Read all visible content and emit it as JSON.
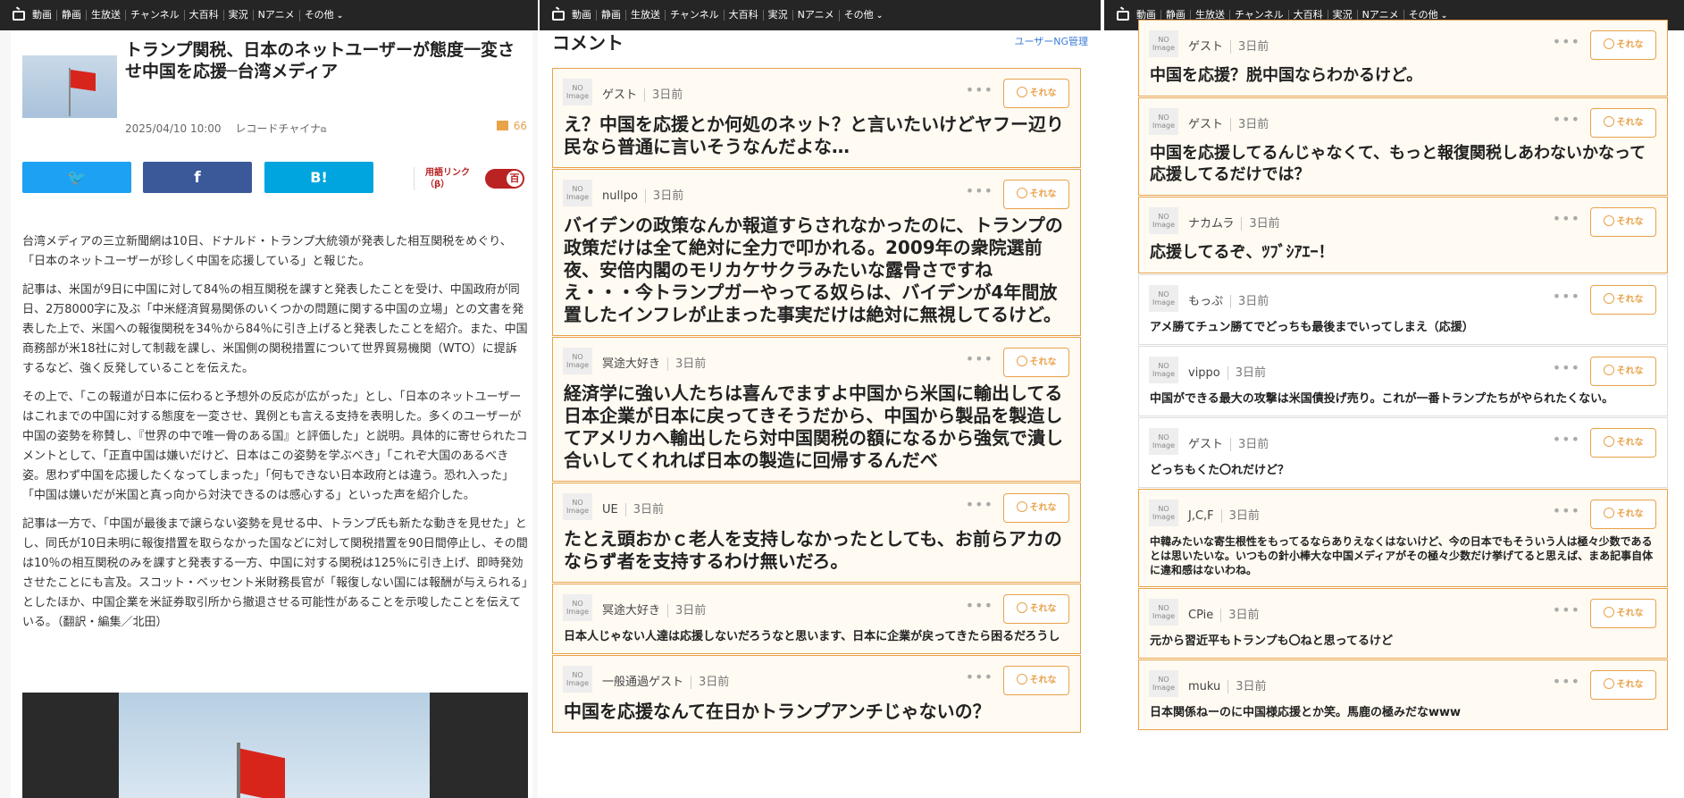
{
  "nav": {
    "items": [
      "動画",
      "静画",
      "生放送",
      "チャンネル",
      "大百科",
      "実況",
      "Nアニメ",
      "その他"
    ]
  },
  "article": {
    "title": "トランプ関税、日本のネットユーザーが態度一変させ中国を応援─台湾メディア",
    "date": "2025/04/10 10:00",
    "source": "レコードチャイナ",
    "comment_count": "66",
    "share": {
      "twitter": "twitter",
      "facebook": "f",
      "hatena": "B!"
    },
    "glossary_link": "用語リンク（β）",
    "toggle": "百",
    "paragraphs": [
      "台湾メディアの三立新聞網は10日、ドナルド・トランプ大統領が発表した相互関税をめぐり、「日本のネットユーザーが珍しく中国を応援している」と報じた。",
      "記事は、米国が9日に中国に対して84％の相互関税を課すと発表したことを受け、中国政府が同日、2万8000字に及ぶ「中米経済貿易関係のいくつかの問題に関する中国の立場」との文書を発表した上で、米国への報復関税を34％から84％に引き上げると発表したことを紹介。また、中国商務部が米18社に対して制裁を課し、米国側の関税措置について世界貿易機関（WTO）に提訴するなど、強く反発していることを伝えた。",
      "その上で、「この報道が日本に伝わると予想外の反応が広がった」とし、「日本のネットユーザーはこれまでの中国に対する態度を一変させ、異例とも言える支持を表明した。多くのユーザーが中国の姿勢を称賛し、『世界の中で唯一骨のある国』と評価した」と説明。具体的に寄せられたコメントとして、「正直中国は嫌いだけど、日本はこの姿勢を学ぶべき」「これぞ大国のあるべき姿。思わず中国を応援したくなってしまった」「何もできない日本政府とは違う。恐れ入った」「中国は嫌いだが米国と真っ向から対決できるのは感心する」といった声を紹介した。",
      "記事は一方で、「中国が最後まで譲らない姿勢を見せる中、トランプ氏も新たな動きを見せた」とし、同氏が10日未明に報復措置を取らなかった国などに対して関税措置を90日間停止し、その間は10％の相互関税のみを課すと発表する一方、中国に対する関税は125％に引き上げ、即時発効させたことにも言及。スコット・ベッセント米財務長官が「報復しない国には報酬が与えられる」としたほか、中国企業を米証券取引所から撤退させる可能性があることを示唆したことを伝えている。（翻訳・編集／北田）"
    ]
  },
  "comments_header": {
    "title": "コメント",
    "ng_manage": "ユーザーNG管理"
  },
  "common": {
    "no_image": "NO Image",
    "sorena": "それな",
    "dots": "•••"
  },
  "comments_mid": [
    {
      "user": "ゲスト",
      "time": "3日前",
      "text": "え？中国を応援とか何処のネット？と言いたいけどヤフー辺り民なら普通に言いそうなんだよな…"
    },
    {
      "user": "nullpo",
      "time": "3日前",
      "text": "バイデンの政策なんか報道すらされなかったのに、トランプの政策だけは全て絶対に全力で叩かれる。2009年の衆院選前夜、安倍内閣のモリカケサクラみたいな露骨さですね　え・・・今トランプガーやってる奴らは、バイデンが4年間放置したインフレが止まった事実だけは絶対に無視してるけど。"
    },
    {
      "user": "冥途大好き",
      "time": "3日前",
      "text": "経済学に強い人たちは喜んでますよ中国から米国に輸出してる日本企業が日本に戻ってきそうだから、中国から製品を製造してアメリカへ輸出したら対中国関税の額になるから強気で潰し合いしてくれれば日本の製造に回帰するんだべ"
    },
    {
      "user": "UE",
      "time": "3日前",
      "text": "たとえ頭おかｃ老人を支持しなかったとしても、お前らアカのならず者を支持するわけ無いだろ。"
    },
    {
      "user": "冥途大好き",
      "time": "3日前",
      "text": "日本人じゃない人達は応援しないだろうなと思います、日本に企業が戻ってきたら困るだろうし"
    },
    {
      "user": "一般通過ゲスト",
      "time": "3日前",
      "text": "中国を応援なんて在日かトランプアンチじゃないの？"
    }
  ],
  "comments_right": [
    {
      "user": "ゲスト",
      "time": "3日前",
      "text": "中国を応援？脱中国ならわかるけど。"
    },
    {
      "user": "ゲスト",
      "time": "3日前",
      "text": "中国を応援してるんじゃなくて、もっと報復関税しあわないかなって応援してるだけでは？"
    },
    {
      "user": "ナカムラ",
      "time": "3日前",
      "text": "応援してるぞ、ﾂﾌﾞｼｱｴｰ！"
    },
    {
      "user": "もっぷ",
      "time": "3日前",
      "text": "アメ勝てチュン勝てでどっちも最後までいってしまえ（応援）"
    },
    {
      "user": "vippo",
      "time": "3日前",
      "text": "中国ができる最大の攻撃は米国債投げ売り。これが一番トランプたちがやられたくない。"
    },
    {
      "user": "ゲスト",
      "time": "3日前",
      "text": "どっちもくた〇れだけど？"
    },
    {
      "user": "J,C,F",
      "time": "3日前",
      "text": "中韓みたいな寄生根性をもってるならありえなくはないけど、今の日本でもそういう人は極々少数であるとは思いたいな。いつもの針小棒大な中国メディアがその極々少数だけ挙げてると思えば、まあ記事自体に違和感はないわね。"
    },
    {
      "user": "CPie",
      "time": "3日前",
      "text": "元から習近平もトランプも〇ねと思ってるけど"
    },
    {
      "user": "muku",
      "time": "3日前",
      "text": "日本関係ねーのに中国様応援とか笑。馬鹿の極みだなwww"
    }
  ]
}
